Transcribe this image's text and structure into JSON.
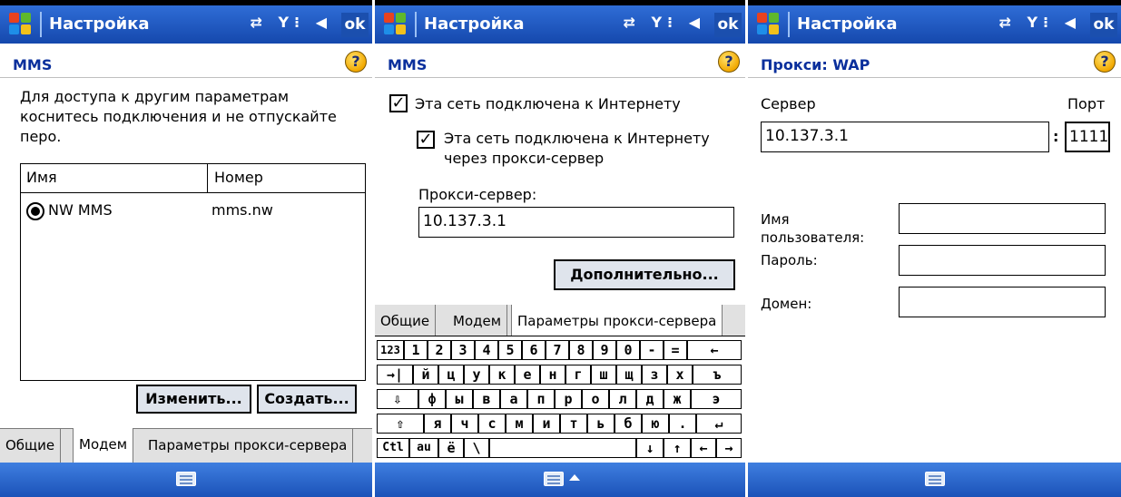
{
  "status_bar": {
    "title": "Настройка",
    "ok_label": "ok",
    "sys_icons": "⇄ Y⁝ ◀"
  },
  "panel1": {
    "page_title": "MMS",
    "instruction": [
      "Для доступа к другим параметрам",
      "коснитесь подключения и не отпускайте",
      "перо."
    ],
    "list": {
      "headers": [
        "Имя",
        "Номер"
      ],
      "rows": [
        {
          "name": "NW MMS",
          "number": "mms.nw"
        }
      ]
    },
    "edit_button": "Изменить...",
    "create_button": "Создать...",
    "tabs": [
      "Общие",
      "Модем",
      "Параметры прокси-сервера"
    ]
  },
  "panel2": {
    "page_title": "MMS",
    "check1": "Эта сеть подключена к Интернету",
    "check2": [
      "Эта сеть подключена к Интернету",
      "через прокси-сервер"
    ],
    "proxy_label": "Прокси-сервер:",
    "proxy_value": "10.137.3.1",
    "advanced_button": "Дополнительно...",
    "tabs": [
      "Общие",
      "Модем",
      "Параметры прокси-сервера"
    ],
    "keyboard": {
      "row1": [
        "123",
        "1",
        "2",
        "3",
        "4",
        "5",
        "6",
        "7",
        "8",
        "9",
        "0",
        "-",
        "=",
        "←"
      ],
      "row2": [
        "→|",
        "й",
        "ц",
        "у",
        "к",
        "е",
        "н",
        "г",
        "ш",
        "щ",
        "з",
        "х",
        "ъ"
      ],
      "row3": [
        "⇩",
        "ф",
        "ы",
        "в",
        "а",
        "п",
        "р",
        "о",
        "л",
        "д",
        "ж",
        "э"
      ],
      "row4": [
        "⇧",
        "я",
        "ч",
        "с",
        "м",
        "и",
        "т",
        "ь",
        "б",
        "ю",
        ".",
        "↵"
      ],
      "row5": [
        "Ctl",
        "au",
        "ё",
        "\\",
        "",
        "↓",
        "↑",
        "←",
        "→"
      ]
    }
  },
  "panel3": {
    "page_title": "Прокси: WAP",
    "server_label": "Сервер",
    "port_label": "Порт",
    "server_value": "10.137.3.1",
    "colon": ":",
    "port_value": "1111",
    "username_label": [
      "Имя",
      "пользователя:"
    ],
    "password_label": "Пароль:",
    "domain_label": "Домен:"
  },
  "colors": {
    "titlebar": "#1548ad",
    "accent_text": "#0a2f9c",
    "tab_bg": "#e1e1e1"
  }
}
